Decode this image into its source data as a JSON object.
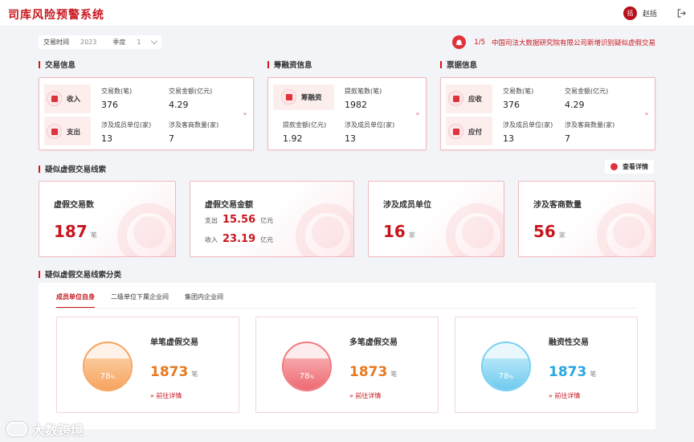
{
  "header": {
    "title": "司库风险预警系统",
    "avatar_text": "括",
    "user_name": "赵括"
  },
  "filter": {
    "label": "交易时间",
    "year": "2023",
    "period_label": "季度",
    "period_value": "1"
  },
  "notice": {
    "count": "1/5",
    "text": "中国司法大数据研究院有限公司新增识别疑似虚假交易"
  },
  "sections": {
    "transaction": "交易信息",
    "financing": "筹融资信息",
    "bill": "票据信息",
    "suspect": "疑似虚假交易线索",
    "category": "疑似虚假交易线索分类"
  },
  "transaction_card": {
    "income": {
      "label": "收入",
      "count_k": "交易数(笔)",
      "count_v": "376",
      "amount_k": "交易金额(亿元)",
      "amount_v": "4.29"
    },
    "expense": {
      "label": "支出",
      "members_k": "涉及成员单位(家)",
      "members_v": "13",
      "clients_k": "涉及客商数量(家)",
      "clients_v": "7"
    }
  },
  "financing_card": {
    "label": "筹融资",
    "count_k": "提款笔数(笔)",
    "count_v": "1982",
    "amount_k": "提款金额(亿元)",
    "amount_v": "1.92",
    "members_k": "涉及成员单位(家)",
    "members_v": "13"
  },
  "bill_card": {
    "receivable": {
      "label": "应收",
      "count_k": "交易数(笔)",
      "count_v": "376",
      "amount_k": "交易金额(亿元)",
      "amount_v": "4.29"
    },
    "payable": {
      "label": "应付",
      "members_k": "涉及成员单位(家)",
      "members_v": "13",
      "clients_k": "涉及客商数量(家)",
      "clients_v": "7"
    }
  },
  "more_symbol": "»",
  "view_detail": "查看详情",
  "suspect": {
    "count": {
      "title": "虚假交易数",
      "value": "187",
      "unit": "笔"
    },
    "amount": {
      "title": "虚假交易金额",
      "out_label": "支出",
      "out_value": "15.56",
      "in_label": "收入",
      "in_value": "23.19",
      "unit": "亿元"
    },
    "members": {
      "title": "涉及成员单位",
      "value": "16",
      "unit": "家"
    },
    "clients": {
      "title": "涉及客商数量",
      "value": "56",
      "unit": "家"
    }
  },
  "tabs": [
    "成员单位自身",
    "二级单位下属企业间",
    "集团内企业间"
  ],
  "categories": [
    {
      "title": "单笔虚假交易",
      "percent": "78",
      "pct_sign": "%",
      "value": "1873",
      "unit": "笔",
      "link": "»  前往详情",
      "color": "#f6a45f",
      "value_color": "#e8791f"
    },
    {
      "title": "多笔虚假交易",
      "percent": "78",
      "pct_sign": "%",
      "value": "1873",
      "unit": "笔",
      "link": "»  前往详情",
      "color": "#f07a80",
      "value_color": "#e8791f"
    },
    {
      "title": "融资性交易",
      "percent": "78",
      "pct_sign": "%",
      "value": "1873",
      "unit": "笔",
      "link": "»  前往详情",
      "color": "#79d0f2",
      "value_color": "#2aa7e0"
    }
  ],
  "watermark": "大数跨境"
}
